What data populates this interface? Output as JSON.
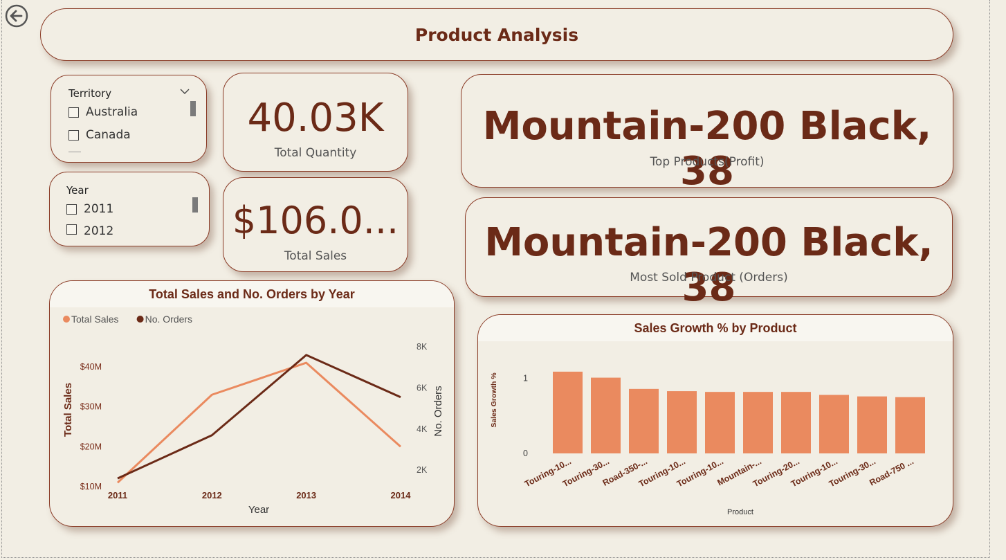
{
  "header": {
    "title": "Product Analysis"
  },
  "slicers": {
    "territory": {
      "label": "Territory",
      "items": [
        "Australia",
        "Canada"
      ]
    },
    "year": {
      "label": "Year",
      "items": [
        "2011",
        "2012"
      ]
    }
  },
  "kpis": {
    "total_quantity": {
      "value": "40.03K",
      "label": "Total Quantity"
    },
    "total_sales": {
      "value": "$106.0...",
      "label": "Total Sales"
    },
    "top_product_profit": {
      "value": "Mountain-200 Black, 38",
      "label": "Top Products(Profit)"
    },
    "most_sold_product": {
      "value": "Mountain-200 Black, 38",
      "label": "Most Sold Product (Orders)"
    }
  },
  "colors": {
    "accent_dark": "#6b2a17",
    "accent_light": "#ea8a5f",
    "background": "#f2eee4"
  },
  "icons": {
    "back": "back-arrow-icon",
    "dropdown": "chevron-down-icon"
  },
  "chart_data": [
    {
      "type": "line",
      "title": "Total Sales and No. Orders by Year",
      "xlabel": "Year",
      "ylabel": "Total Sales",
      "y2label": "No. Orders",
      "categories": [
        "2011",
        "2012",
        "2013",
        "2014"
      ],
      "legend_position": "top-left",
      "series": [
        {
          "name": "Total Sales",
          "axis": "left",
          "color": "#ea8a5f",
          "values": [
            11.0,
            33.0,
            41.0,
            20.0
          ]
        },
        {
          "name": "No. Orders",
          "axis": "right",
          "color": "#6b2a17",
          "values": [
            1600,
            3700,
            7600,
            5550
          ]
        }
      ],
      "y_ticks": [
        "$10M",
        "$20M",
        "$30M",
        "$40M"
      ],
      "y_tick_values": [
        10,
        20,
        30,
        40
      ],
      "y_range": [
        10,
        45
      ],
      "y2_ticks": [
        "2K",
        "4K",
        "6K",
        "8K"
      ],
      "y2_tick_values": [
        2000,
        4000,
        6000,
        8000
      ],
      "y2_range": [
        1200,
        8000
      ]
    },
    {
      "type": "bar",
      "title": "Sales Growth % by Product",
      "xlabel": "Product",
      "ylabel": "Sales Growth %",
      "categories": [
        "Touring-10...",
        "Touring-30...",
        "Road-350-...",
        "Touring-10...",
        "Touring-10...",
        "Mountain-...",
        "Touring-20...",
        "Touring-10...",
        "Touring-30...",
        "Road-750 ..."
      ],
      "values": [
        1.09,
        1.01,
        0.86,
        0.83,
        0.82,
        0.82,
        0.82,
        0.78,
        0.76,
        0.75
      ],
      "y_ticks": [
        "0",
        "1"
      ],
      "y_tick_values": [
        0,
        1
      ],
      "ylim": [
        0,
        1.2
      ],
      "color": "#ea8a5f"
    }
  ]
}
